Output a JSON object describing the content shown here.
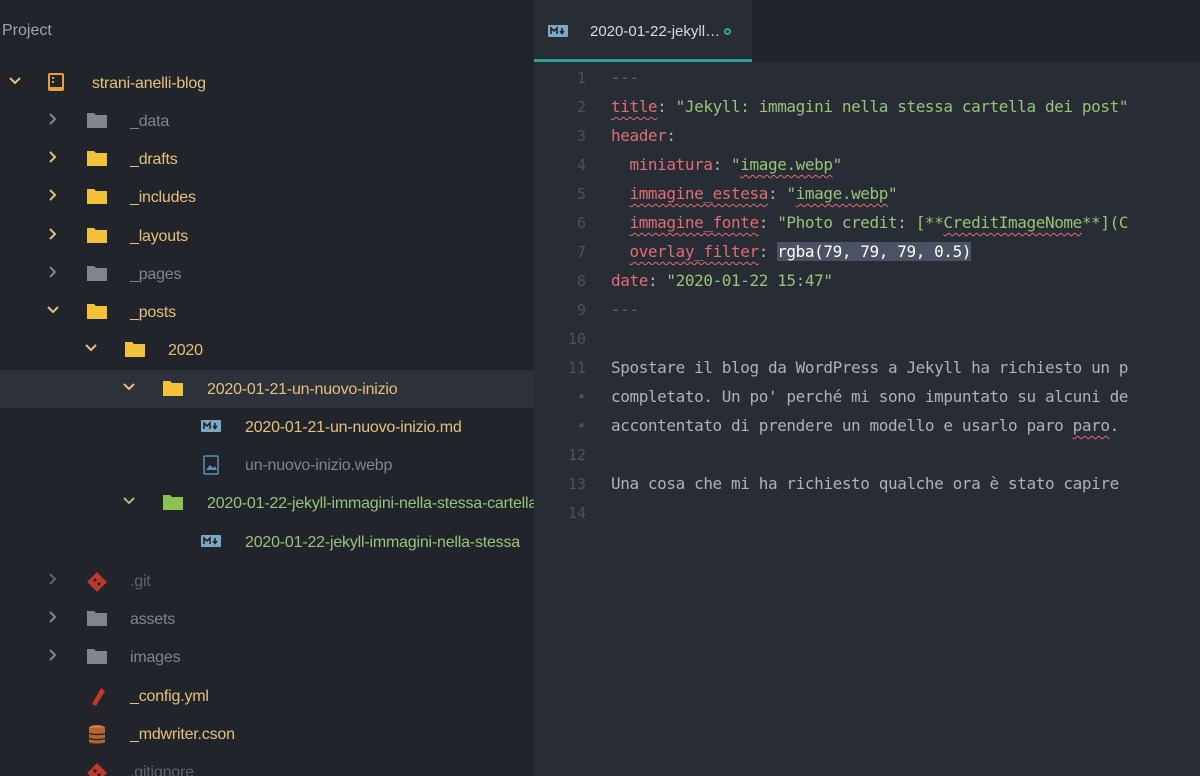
{
  "sidebar": {
    "title": "Project",
    "items": [
      {
        "label": "strani-anelli-blog",
        "icon": "repo-icon",
        "chevron": "down"
      },
      {
        "label": "_data",
        "icon": "folder-icon",
        "chevron": "right"
      },
      {
        "label": "_drafts",
        "icon": "folder-icon",
        "chevron": "right"
      },
      {
        "label": "_includes",
        "icon": "folder-icon",
        "chevron": "right"
      },
      {
        "label": "_layouts",
        "icon": "folder-icon",
        "chevron": "right"
      },
      {
        "label": "_pages",
        "icon": "folder-icon",
        "chevron": "right"
      },
      {
        "label": "_posts",
        "icon": "folder-icon",
        "chevron": "down"
      },
      {
        "label": "2020",
        "icon": "folder-icon",
        "chevron": "down"
      },
      {
        "label": "2020-01-21-un-nuovo-inizio",
        "icon": "folder-icon",
        "chevron": "down"
      },
      {
        "label": "2020-01-21-un-nuovo-inizio.md",
        "icon": "markdown-icon",
        "chevron": ""
      },
      {
        "label": "un-nuovo-inizio.webp",
        "icon": "image-file-icon",
        "chevron": ""
      },
      {
        "label": "2020-01-22-jekyll-immagini-nella-stessa-cartella",
        "icon": "folder-icon",
        "chevron": "down"
      },
      {
        "label": "2020-01-22-jekyll-immagini-nella-stessa",
        "icon": "markdown-icon",
        "chevron": ""
      },
      {
        "label": ".git",
        "icon": "git-icon",
        "chevron": "right"
      },
      {
        "label": "assets",
        "icon": "folder-icon",
        "chevron": "right"
      },
      {
        "label": "images",
        "icon": "folder-icon",
        "chevron": "right"
      },
      {
        "label": "_config.yml",
        "icon": "config-icon",
        "chevron": ""
      },
      {
        "label": "_mdwriter.cson",
        "icon": "database-icon",
        "chevron": ""
      },
      {
        "label": ".gitignore",
        "icon": "git-icon",
        "chevron": ""
      }
    ]
  },
  "editor": {
    "tab": {
      "label": "2020-01-22-jekyll…",
      "icon": "markdown-icon"
    },
    "lines": [
      {
        "n": "1",
        "parts": [
          "---"
        ]
      },
      {
        "n": "2",
        "parts": [
          "title",
          ": ",
          "\"Jekyll: immagini nella stessa cartella dei post\""
        ]
      },
      {
        "n": "3",
        "parts": [
          "header",
          ":"
        ]
      },
      {
        "n": "4",
        "parts": [
          "  ",
          "miniatura",
          ": ",
          "\"",
          "image.webp",
          "\""
        ]
      },
      {
        "n": "5",
        "parts": [
          "  ",
          "immagine_estesa",
          ": ",
          "\"",
          "image.webp",
          "\""
        ]
      },
      {
        "n": "6",
        "parts": [
          "  ",
          "immagine_fonte",
          ": ",
          "\"Photo credit: [**",
          "CreditImageNome",
          "**](C"
        ]
      },
      {
        "n": "7",
        "parts": [
          "  ",
          "overlay_filter",
          ": ",
          "rgba(79, 79, 79, 0.5)"
        ]
      },
      {
        "n": "8",
        "parts": [
          "date",
          ": ",
          "\"2020-01-22 15:47\""
        ]
      },
      {
        "n": "9",
        "parts": [
          "---"
        ]
      },
      {
        "n": "10",
        "parts": [
          ""
        ]
      },
      {
        "n": "11",
        "parts": [
          "Spostare il blog da WordPress a Jekyll ha richiesto un p"
        ]
      },
      {
        "n": "•",
        "parts": [
          "completato. Un po' perché mi sono impuntato su alcuni de"
        ]
      },
      {
        "n": "•",
        "parts": [
          "accontentato di prendere un modello e usarlo paro ",
          "paro",
          "."
        ]
      },
      {
        "n": "12",
        "parts": [
          ""
        ]
      },
      {
        "n": "13",
        "parts": [
          "Una cosa che mi ha richiesto qualche ora è stato capire"
        ]
      },
      {
        "n": "14",
        "parts": [
          ""
        ]
      }
    ]
  },
  "colors": {
    "accent": "#2ba39b",
    "folder_yellow": "#e5c07b",
    "folder_green": "#98c379",
    "yaml_key": "#e06c75",
    "string": "#98c379"
  }
}
